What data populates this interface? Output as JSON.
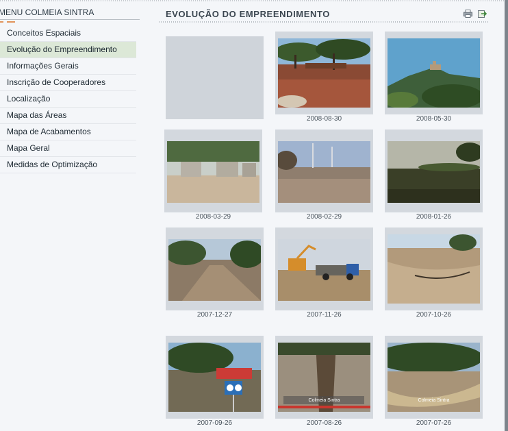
{
  "sidebar": {
    "title": "MENU COLMEIA SINTRA",
    "items": [
      {
        "label": "Conceitos Espaciais"
      },
      {
        "label": "Evolução do Empreendimento"
      },
      {
        "label": "Informações Gerais"
      },
      {
        "label": "Inscrição de Cooperadores"
      },
      {
        "label": "Localização"
      },
      {
        "label": "Mapa das Áreas"
      },
      {
        "label": "Mapa de Acabamentos"
      },
      {
        "label": "Mapa Geral"
      },
      {
        "label": "Medidas de Optimização"
      }
    ],
    "active_index": 1
  },
  "main": {
    "title": "EVOLUÇÃO DO EMPREENDIMENTO",
    "icons": [
      "printer-icon",
      "export-icon"
    ],
    "photos": [
      {
        "date": ""
      },
      {
        "date": "2008-08-30"
      },
      {
        "date": "2008-05-30"
      },
      {
        "date": "2008-03-29"
      },
      {
        "date": "2008-02-29"
      },
      {
        "date": "2008-01-26"
      },
      {
        "date": "2007-12-27"
      },
      {
        "date": "2007-11-26"
      },
      {
        "date": "2007-10-26"
      },
      {
        "date": "2007-09-26"
      },
      {
        "date": "2007-08-26",
        "watermark": "Colmeia Sintra"
      },
      {
        "date": "2007-07-26",
        "watermark": "Colmeia Sintra"
      }
    ]
  },
  "colors": {
    "active_menu_bg": "#dce8d7",
    "accent": "#e2935a",
    "page_bg": "#f4f6f9",
    "card_bg": "#d3d8de"
  }
}
